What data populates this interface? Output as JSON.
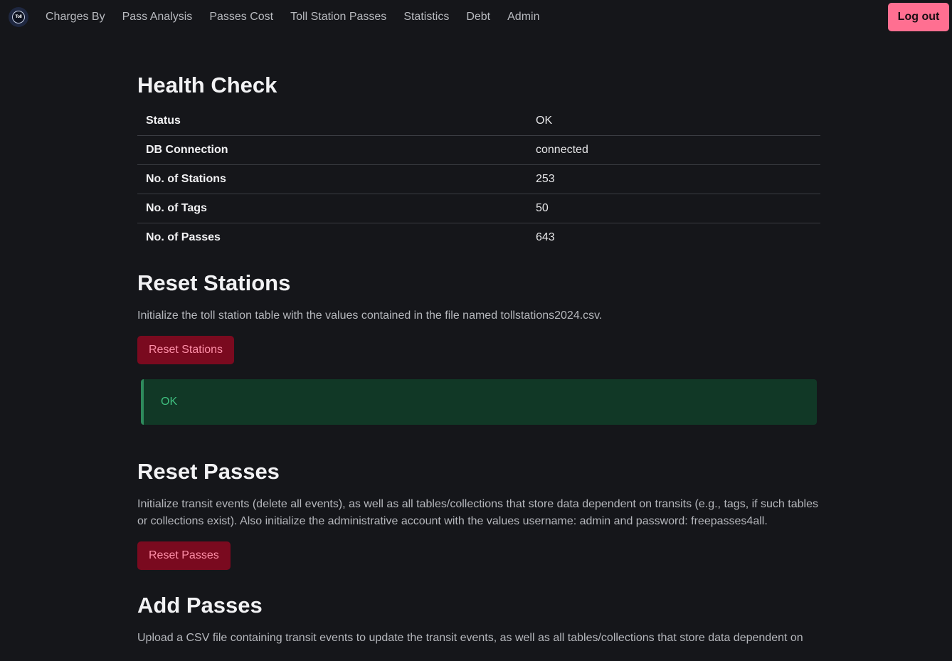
{
  "nav": {
    "logo_text": "Toll",
    "items": [
      {
        "label": "Charges By"
      },
      {
        "label": "Pass Analysis"
      },
      {
        "label": "Passes Cost"
      },
      {
        "label": "Toll Station Passes"
      },
      {
        "label": "Statistics"
      },
      {
        "label": "Debt"
      },
      {
        "label": "Admin"
      }
    ],
    "logout_label": "Log out"
  },
  "health": {
    "title": "Health Check",
    "rows": [
      {
        "key": "Status",
        "value": "OK"
      },
      {
        "key": "DB Connection",
        "value": "connected"
      },
      {
        "key": "No. of Stations",
        "value": "253"
      },
      {
        "key": "No. of Tags",
        "value": "50"
      },
      {
        "key": "No. of Passes",
        "value": "643"
      }
    ]
  },
  "reset_stations": {
    "title": "Reset Stations",
    "description": "Initialize the toll station table with the values contained in the file named tollstations2024.csv.",
    "button_label": "Reset Stations",
    "result": "OK"
  },
  "reset_passes": {
    "title": "Reset Passes",
    "description": "Initialize transit events (delete all events), as well as all tables/collections that store data dependent on transits (e.g., tags, if such tables or collections exist). Also initialize the administrative account with the values username: admin and password: freepasses4all.",
    "button_label": "Reset Passes"
  },
  "add_passes": {
    "title": "Add Passes",
    "description": "Upload a CSV file containing transit events to update the transit events, as well as all tables/collections that store data dependent on"
  },
  "colors": {
    "background": "#15161a",
    "logout": "#ff6f91",
    "danger_button": "#7a0a1f",
    "success_bg": "#113826",
    "success_text": "#3fbf7f"
  }
}
